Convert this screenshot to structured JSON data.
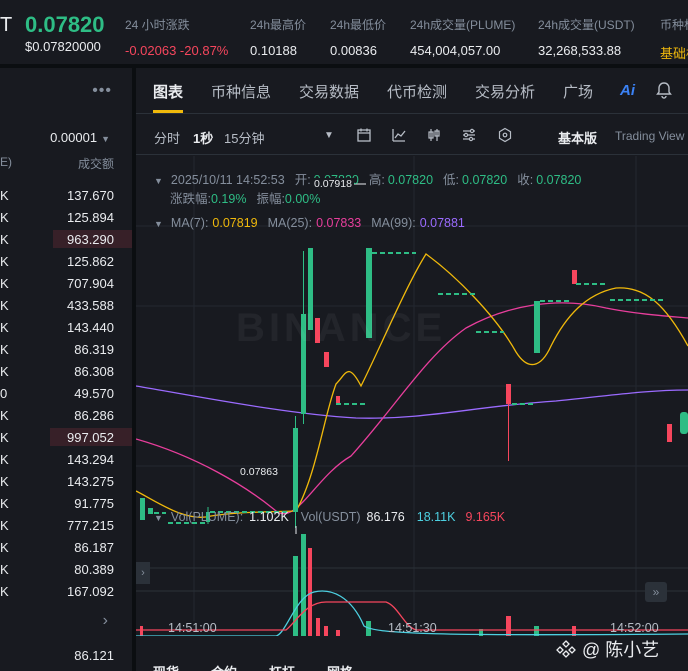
{
  "ticker": {
    "pair_fragment": "T",
    "price": "0.07820",
    "price_usd": "$0.07820000",
    "stats": [
      {
        "label": "24 小时涨跌",
        "value": "-0.02063 -20.87%",
        "tone": "red"
      },
      {
        "label": "24h最高价",
        "value": "0.10188",
        "tone": ""
      },
      {
        "label": "24h最低价",
        "value": "0.00836",
        "tone": ""
      },
      {
        "label": "24h成交量(PLUME)",
        "value": "454,004,057.00",
        "tone": ""
      },
      {
        "label": "24h成交量(USDT)",
        "value": "32,268,533.88",
        "tone": ""
      },
      {
        "label": "币种标",
        "value": "基础标",
        "tone": "gold"
      }
    ]
  },
  "book": {
    "precision": "0.00001",
    "header_left": "E)",
    "header_right": "成交额",
    "rows": [
      {
        "left": "K",
        "right": "137.670",
        "fill": 0
      },
      {
        "left": "K",
        "right": "125.894",
        "fill": 0
      },
      {
        "left": "K",
        "right": "963.290",
        "fill": 0.6
      },
      {
        "left": "K",
        "right": "125.862",
        "fill": 0
      },
      {
        "left": "K",
        "right": "707.904",
        "fill": 0
      },
      {
        "left": "K",
        "right": "433.588",
        "fill": 0
      },
      {
        "left": "K",
        "right": "143.440",
        "fill": 0
      },
      {
        "left": "K",
        "right": "86.319",
        "fill": 0
      },
      {
        "left": "K",
        "right": "86.308",
        "fill": 0
      },
      {
        "left": "0",
        "right": "49.570",
        "fill": 0
      },
      {
        "left": "K",
        "right": "86.286",
        "fill": 0
      },
      {
        "left": "K",
        "right": "997.052",
        "fill": 0.62
      },
      {
        "left": "K",
        "right": "143.294",
        "fill": 0
      },
      {
        "left": "K",
        "right": "143.275",
        "fill": 0
      },
      {
        "left": "K",
        "right": "91.775",
        "fill": 0
      },
      {
        "left": "K",
        "right": "777.215",
        "fill": 0
      },
      {
        "left": "K",
        "right": "86.187",
        "fill": 0
      },
      {
        "left": "K",
        "right": "80.389",
        "fill": 0
      },
      {
        "left": "K",
        "right": "167.092",
        "fill": 0
      }
    ],
    "last_value": "86.121"
  },
  "tabs": [
    "图表",
    "币种信息",
    "交易数据",
    "代币检测",
    "交易分析",
    "广场"
  ],
  "ai_label": "Ai",
  "tools": {
    "t1": "分时",
    "t2": "1秒",
    "t3": "15分钟",
    "version_basic": "基本版",
    "version_tv": "Trading View"
  },
  "ohlc": {
    "datetime": "2025/10/11 14:52:53",
    "open_label": "开:",
    "open": "0.07820",
    "high_label": "高:",
    "high": "0.07820",
    "low_label": "低:",
    "low": "0.07820",
    "close_label": "收:",
    "close": "0.07820",
    "change_label": "涨跌幅:",
    "change": "0.19%",
    "amp_label": "振幅:",
    "amp": "0.00%"
  },
  "ma": {
    "ma7_label": "MA(7):",
    "ma7": "0.07819",
    "ma25_label": "MA(25):",
    "ma25": "0.07833",
    "ma99_label": "MA(99):",
    "ma99": "0.07881"
  },
  "vol": {
    "label": "Vol(PLUME):",
    "value": "1.102K",
    "usdt_label": "Vol(USDT)",
    "usdt": "86.176",
    "c": "18.11K",
    "m": "9.165K"
  },
  "price_marks": {
    "high": "0.07918",
    "low": "0.07863"
  },
  "time_labels": [
    "14:51:00",
    "14:51:30",
    "14:52:00"
  ],
  "bottom_tabs": [
    "现货",
    "合约",
    "杠杆",
    "网格"
  ],
  "credit": "@ 陈小艺",
  "colors": {
    "up": "#2ebd85",
    "down": "#f6465d",
    "ma7": "#f0b90b",
    "ma25": "#e83e9c",
    "ma99": "#9b6bff",
    "accent": "#f0b90b"
  }
}
